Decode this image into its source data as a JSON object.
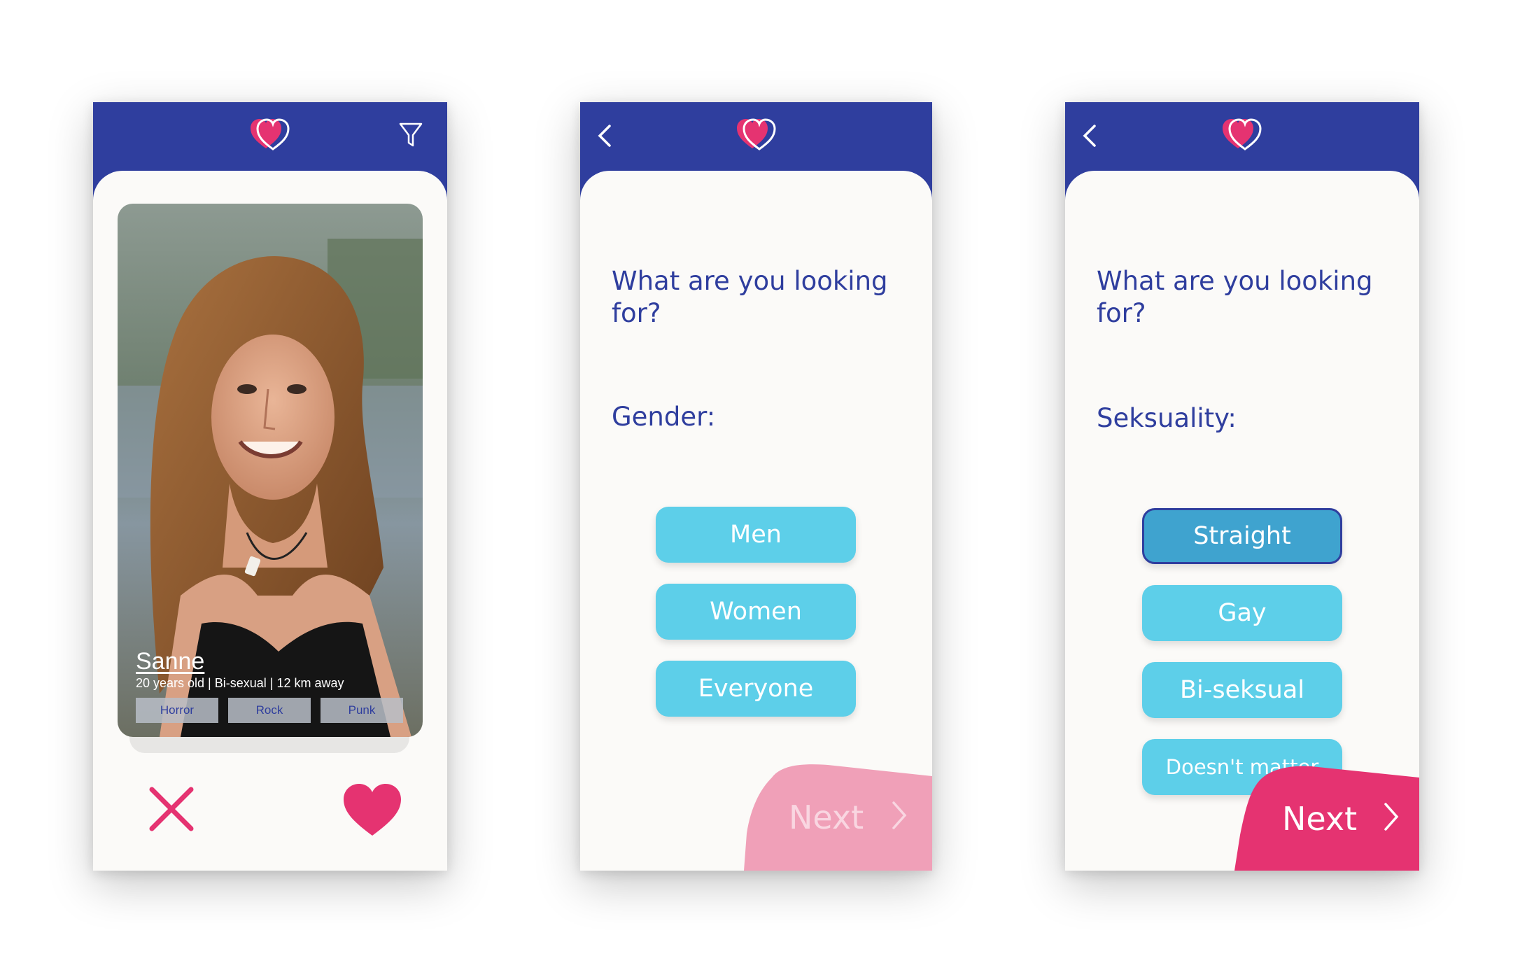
{
  "screens": {
    "profile": {
      "name": "Sanne",
      "details": "20 years old | Bi-sexual | 12 km away",
      "tags": [
        "Horror",
        "Rock",
        "Punk"
      ]
    },
    "gender": {
      "question": "What are you looking for?",
      "label": "Gender:",
      "options": [
        "Men",
        "Women",
        "Everyone"
      ],
      "next": "Next"
    },
    "sexuality": {
      "question": "What are you looking for?",
      "label": "Seksuality:",
      "options": [
        "Straight",
        "Gay",
        "Bi-seksual",
        "Doesn't matter"
      ],
      "selected": "Straight",
      "next": "Next"
    }
  },
  "colors": {
    "header": "#2f3e9e",
    "accent_pink": "#e53371",
    "option": "#5dcfe9",
    "option_selected": "#3fa3cf",
    "next_disabled": "#f0a0b8"
  },
  "icons": [
    "heart-logo-icon",
    "filter-icon",
    "back-chevron-icon",
    "close-x-icon",
    "heart-like-icon",
    "next-chevron-icon"
  ]
}
